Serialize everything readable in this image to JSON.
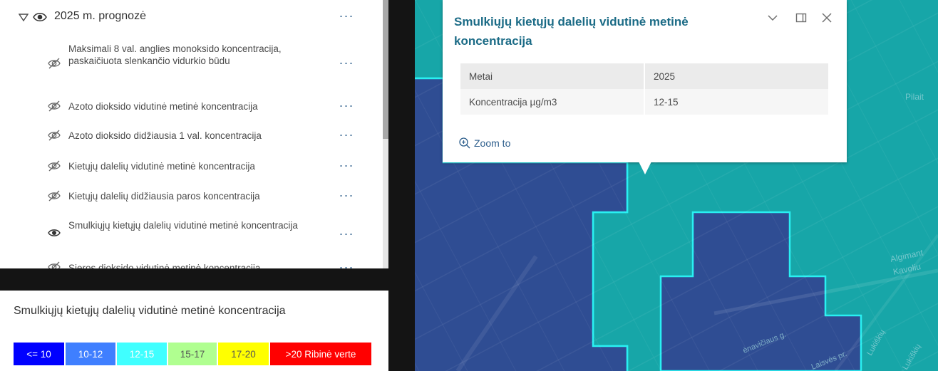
{
  "layer_list": {
    "group": {
      "title": "2025 m. prognozė",
      "more_label": "···"
    },
    "items": [
      {
        "label": "Maksimali 8 val. anglies monoksido koncentracija, paskaičiuota slenkančio vidurkio būdu",
        "visible": false,
        "more_label": "···"
      },
      {
        "label": "Azoto dioksido vidutinė metinė koncentracija",
        "visible": false,
        "more_label": "···"
      },
      {
        "label": "Azoto dioksido didžiausia 1 val. koncentracija",
        "visible": false,
        "more_label": "···"
      },
      {
        "label": "Kietųjų dalelių vidutinė metinė koncentracija",
        "visible": false,
        "more_label": "···"
      },
      {
        "label": "Kietųjų dalelių didžiausia paros koncentracija",
        "visible": false,
        "more_label": "···"
      },
      {
        "label": "Smulkiųjų kietųjų dalelių vidutinė metinė koncentracija",
        "visible": true,
        "more_label": "···"
      },
      {
        "label": "Sieros dioksido vidutinė metinė koncentracija",
        "visible": false,
        "more_label": "···"
      }
    ]
  },
  "legend": {
    "title": "Smulkiųjų kietųjų dalelių vidutinė metinė koncentracija",
    "classes": [
      {
        "label": "<= 10",
        "color": "#0000ff",
        "text_color": "#ffffff"
      },
      {
        "label": "10-12",
        "color": "#3f7fff",
        "text_color": "#ffffff"
      },
      {
        "label": "12-15",
        "color": "#40ffff",
        "text_color": "#ffffff"
      },
      {
        "label": "15-17",
        "color": "#b0ff90",
        "text_color": "#555555"
      },
      {
        "label": "17-20",
        "color": "#ffff00",
        "text_color": "#555555"
      },
      {
        "label": ">20 Ribinė verte",
        "color": "#ff0000",
        "text_color": "#ffffff"
      }
    ]
  },
  "popup": {
    "title": "Smulkiųjų kietųjų dalelių vidutinė metinė koncentracija",
    "rows": [
      {
        "field": "Metai",
        "value": "2025"
      },
      {
        "field": "Koncentracija µg/m3",
        "value": "12-15"
      }
    ],
    "zoom_label": "Zoom to"
  },
  "map": {
    "colors": {
      "low_zone": "#2f4d93",
      "mid_zone": "#17a6a8",
      "zone_outline": "#29f0f2"
    },
    "street_labels": [
      "Pilait",
      "Algimant",
      "Kavoliu",
      "Lukiškių",
      "Lukiškių",
      "ėnavičiaus g.",
      "Laisvės pr."
    ]
  }
}
